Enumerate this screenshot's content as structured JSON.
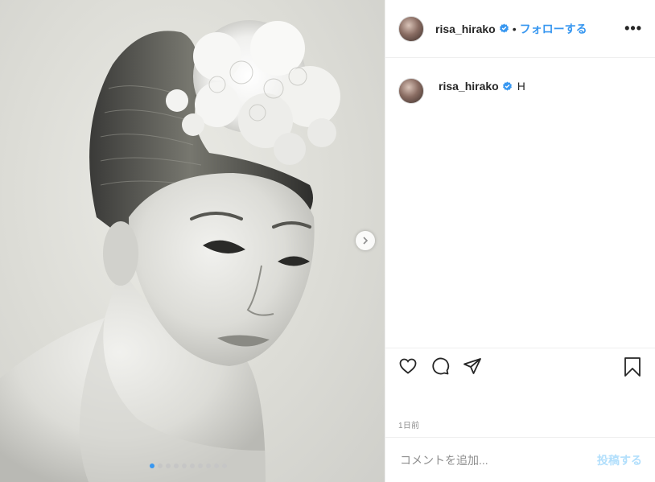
{
  "header": {
    "username": "risa_hirako",
    "separator": "•",
    "follow_label": "フォローする",
    "more_label": "•••",
    "verified_icon": "verified-badge-icon"
  },
  "caption": {
    "username": "risa_hirako",
    "text": "H",
    "verified_icon": "verified-badge-icon"
  },
  "carousel": {
    "slide_count": 10,
    "active_index": 0,
    "next_icon": "chevron-right-icon"
  },
  "actions": {
    "like_icon": "heart-icon",
    "comment_icon": "comment-icon",
    "share_icon": "paper-plane-icon",
    "save_icon": "bookmark-icon"
  },
  "timestamp": "1日前",
  "comment": {
    "placeholder": "コメントを追加...",
    "post_label": "投稿する"
  },
  "colors": {
    "accent": "#3897f0",
    "post_disabled": "#b2dffc",
    "border": "#efefef",
    "muted": "#8e8e8e"
  }
}
